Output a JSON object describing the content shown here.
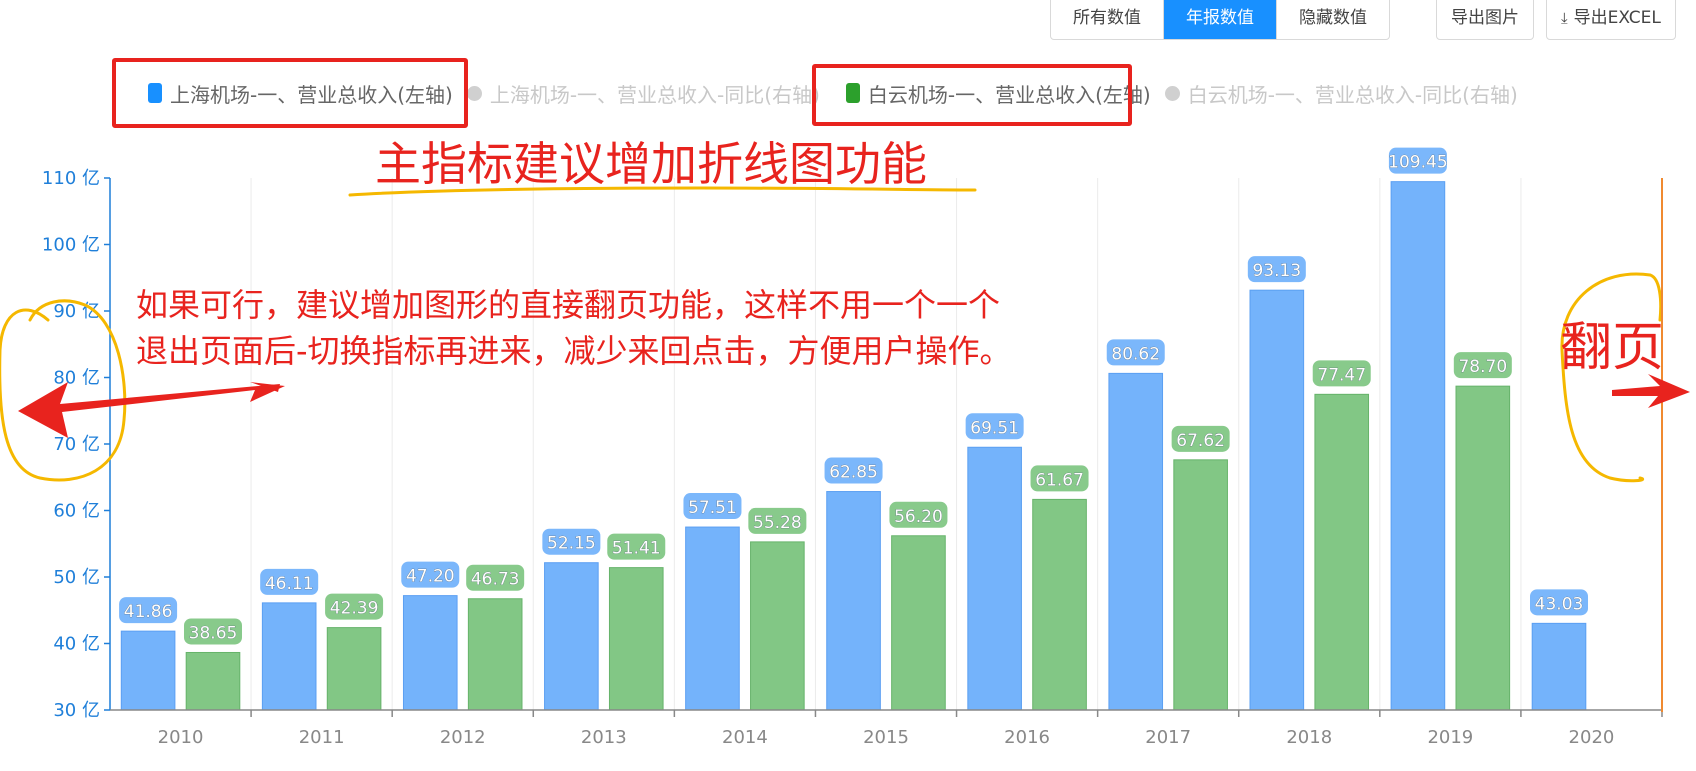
{
  "toolbar": {
    "segments": [
      {
        "label": "所有数值",
        "active": false
      },
      {
        "label": "年报数值",
        "active": true
      },
      {
        "label": "隐藏数值",
        "active": false
      }
    ],
    "export_image_label": "导出图片",
    "export_excel_label": "导出EXCEL",
    "export_excel_icon": "download-icon"
  },
  "legend": [
    {
      "label": "上海机场-一、营业总收入(左轴)",
      "color": "#1890ff",
      "active": true
    },
    {
      "label": "上海机场-一、营业总收入-同比(右轴)",
      "color": "#cccccc",
      "active": false
    },
    {
      "label": "白云机场-一、营业总收入(左轴)",
      "color": "#2ca02c",
      "active": true
    },
    {
      "label": "白云机场-一、营业总收入-同比(右轴)",
      "color": "#cccccc",
      "active": false
    }
  ],
  "annotations": {
    "main_suggestion": "主指标建议增加折线图功能",
    "paging_line1": "如果可行，建议增加图形的直接翻页功能，这样不用一个一个",
    "paging_line2": "退出页面后-切换指标再进来，减少来回点击，方便用户操作。",
    "page_turn": "翻页"
  },
  "colors": {
    "blue_bar": "#74b3fb",
    "blue_edge": "#5b9ff2",
    "green_bar": "#82c785",
    "green_edge": "#66b36a",
    "axis": "#1f7fd9",
    "annotation_red": "#e8231e",
    "annotation_yellow": "#f5b800",
    "right_marker": "#f08a30"
  },
  "chart_data": {
    "type": "bar",
    "categories": [
      "2010",
      "2011",
      "2012",
      "2013",
      "2014",
      "2015",
      "2016",
      "2017",
      "2018",
      "2019",
      "2020"
    ],
    "series": [
      {
        "name": "上海机场-一、营业总收入(左轴)",
        "values": [
          41.86,
          46.11,
          47.2,
          52.15,
          57.51,
          62.85,
          69.51,
          80.62,
          93.13,
          109.45,
          43.03
        ]
      },
      {
        "name": "白云机场-一、营业总收入(左轴)",
        "values": [
          38.65,
          42.39,
          46.73,
          51.41,
          55.28,
          56.2,
          61.67,
          67.62,
          77.47,
          78.7,
          null
        ]
      }
    ],
    "y_ticks": [
      "30 亿",
      "40 亿",
      "50 亿",
      "60 亿",
      "70 亿",
      "80 亿",
      "90 亿",
      "100 亿",
      "110 亿"
    ],
    "ylim": [
      30,
      110
    ],
    "grid": "vertical",
    "data_labels": true
  }
}
